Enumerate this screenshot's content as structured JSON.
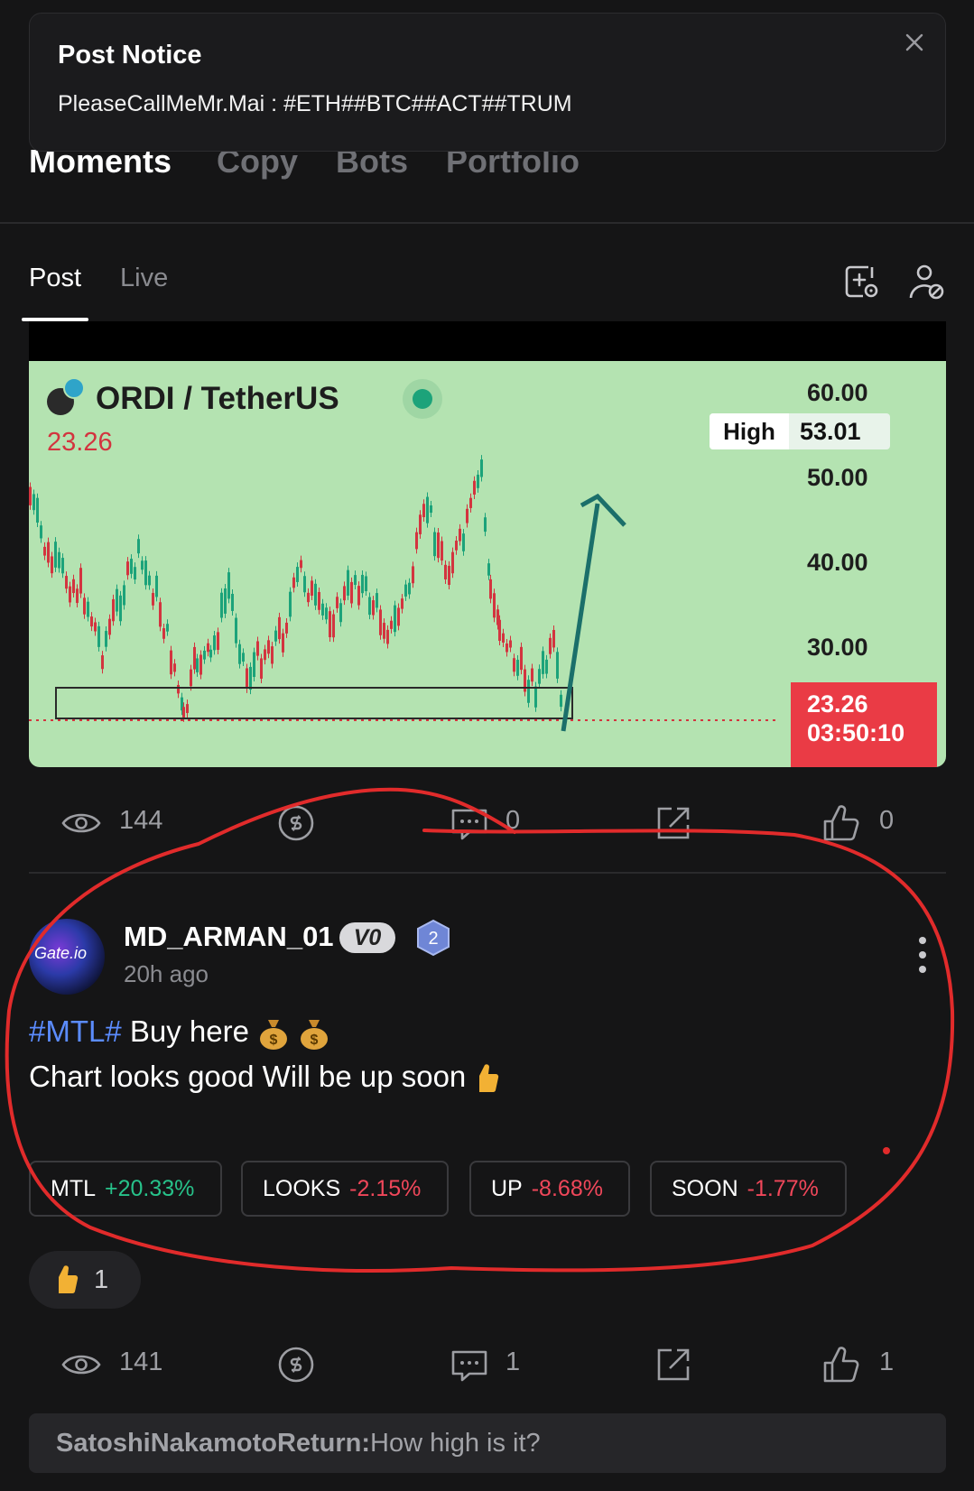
{
  "notice": {
    "title": "Post Notice",
    "body": "PleaseCallMeMr.Mai : #ETH##BTC##ACT##TRUM"
  },
  "top_tabs": [
    "Moments",
    "Copy",
    "Bots",
    "Portfolio"
  ],
  "sub_tabs": [
    "Post",
    "Live"
  ],
  "chart": {
    "pair": "ORDI / TetherUS",
    "last_price": "23.26",
    "high_label": "High",
    "high_value": "53.01",
    "y_ticks": [
      "60.00",
      "50.00",
      "40.00",
      "30.00"
    ],
    "current_price": "23.26",
    "countdown": "03:50:10",
    "colors": {
      "background": "#b4e3b1",
      "down": "#d3343f",
      "up": "#1ca37a",
      "arrow": "#1b6f6a"
    }
  },
  "post1_stats": {
    "views": "144",
    "comments": "0",
    "likes": "0"
  },
  "post2": {
    "avatar_text": "Gate.io",
    "username": "MD_ARMAN_01",
    "vip": "V0",
    "level": "2",
    "time": "20h ago",
    "hashtag": "#MTL#",
    "line1_text": " Buy here ",
    "line2_text": "Chart looks good Will be up soon ",
    "tickers": [
      {
        "symbol": "MTL",
        "change": "+20.33%",
        "direction": "up"
      },
      {
        "symbol": "LOOKS",
        "change": "-2.15%",
        "direction": "down"
      },
      {
        "symbol": "UP",
        "change": "-8.68%",
        "direction": "down"
      },
      {
        "symbol": "SOON",
        "change": "-1.77%",
        "direction": "down"
      }
    ],
    "reaction_count": "1",
    "stats": {
      "views": "141",
      "comments": "1",
      "likes": "1"
    },
    "comment_preview": {
      "author": "SatoshiNakamotoReturn:",
      "text": "How high is it?"
    }
  }
}
